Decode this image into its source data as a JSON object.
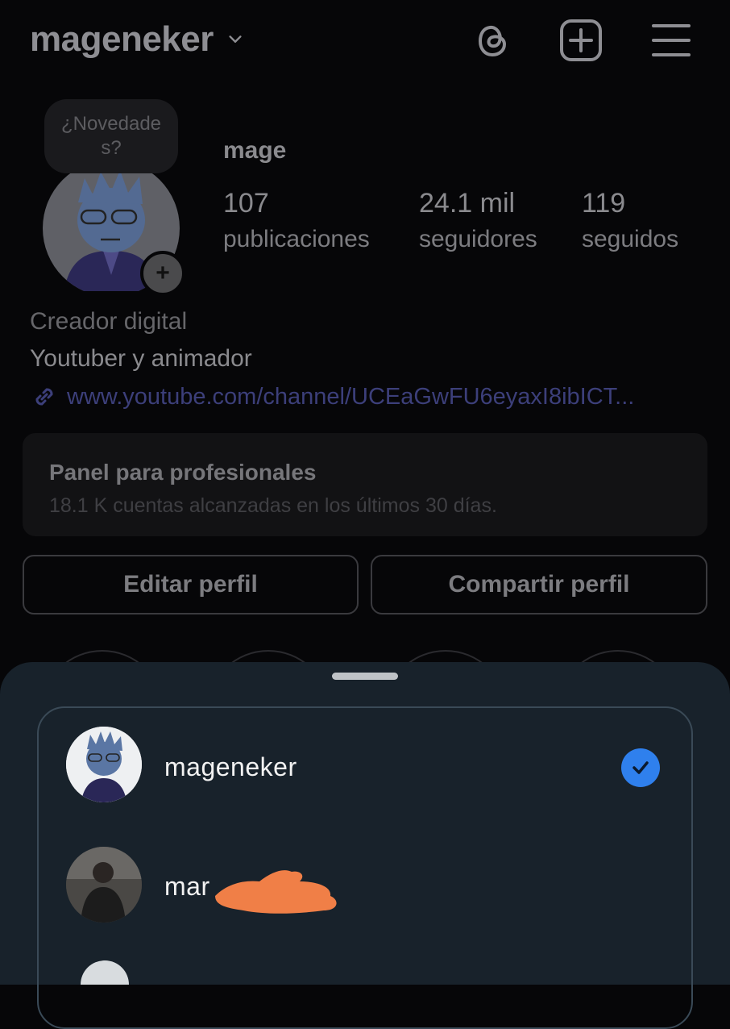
{
  "header": {
    "username": "mageneker",
    "icons": [
      "chevron-down-icon",
      "threads-icon",
      "add-post-icon",
      "menu-icon"
    ]
  },
  "profile": {
    "tooltip": "¿Novedades?",
    "display_name": "mage",
    "stats": [
      {
        "value": "107",
        "label": "publicaciones"
      },
      {
        "value": "24.1 mil",
        "label": "seguidores"
      },
      {
        "value": "119",
        "label": "seguidos"
      }
    ],
    "category": "Creador digital",
    "bio": "Youtuber y animador",
    "link": "www.youtube.com/channel/UCEaGwFU6eyaxI8ibICT..."
  },
  "professional_panel": {
    "title": "Panel para profesionales",
    "subtitle": "18.1 K cuentas alcanzadas en los últimos 30 días."
  },
  "buttons": {
    "edit": "Editar perfil",
    "share": "Compartir perfil"
  },
  "account_switcher": {
    "accounts": [
      {
        "name": "mageneker",
        "selected": true
      },
      {
        "name": "mar",
        "selected": false
      }
    ]
  },
  "colors": {
    "background": "#060608",
    "sheet": "#18222b",
    "check_blue": "#2f80ed",
    "link": "#3c3f7a",
    "redaction": "#f07f47"
  }
}
